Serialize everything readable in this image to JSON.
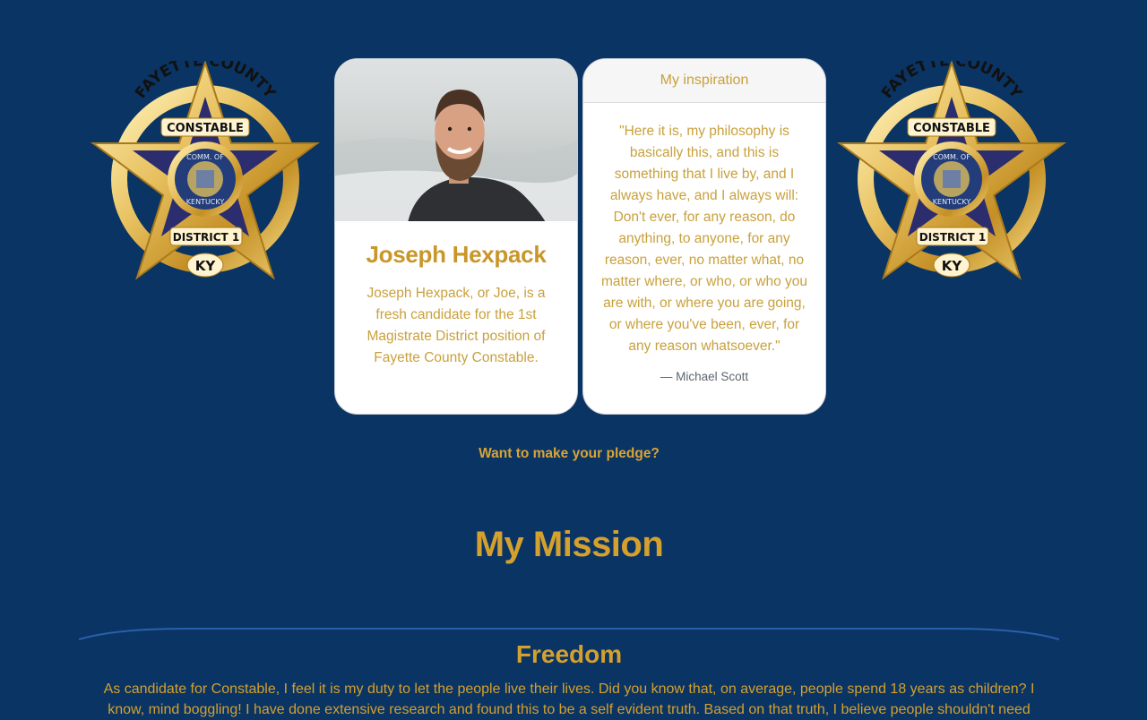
{
  "badge": {
    "top_text": "FAYETTE COUNTY",
    "banner_text": "CONSTABLE",
    "seal_text_top": "COMM. OF",
    "seal_text_bottom": "KENTUCKY",
    "district_text": "DISTRICT 1",
    "state_text": "KY"
  },
  "profile": {
    "name": "Joseph Hexpack",
    "bio": "Joseph Hexpack, or Joe, is a fresh candidate for the 1st Magistrate District position of Fayette County Constable."
  },
  "inspiration": {
    "header": "My inspiration",
    "quote": "\"Here it is, my philosophy is basically this, and this is something that I live by, and I always have, and I always will: Don't ever, for any reason, do anything, to anyone, for any reason, ever, no matter what, no matter where, or who, or who you are with, or where you are going, or where you've been, ever, for any reason whatsoever.\"",
    "author": "— Michael Scott"
  },
  "pledge_link": "Want to make your pledge?",
  "mission": {
    "title": "My Mission",
    "sections": [
      {
        "title": "Freedom",
        "text": "As candidate for Constable, I feel it is my duty to let the people live their lives. Did you know that, on average, people spend 18 years as children? I know, mind boggling! I have done extensive research and found this to be a self evident truth. Based on that truth, I believe people shouldn't need"
      }
    ]
  },
  "colors": {
    "background": "#0a3463",
    "gold": "#d4a02e",
    "card": "#ffffff"
  }
}
